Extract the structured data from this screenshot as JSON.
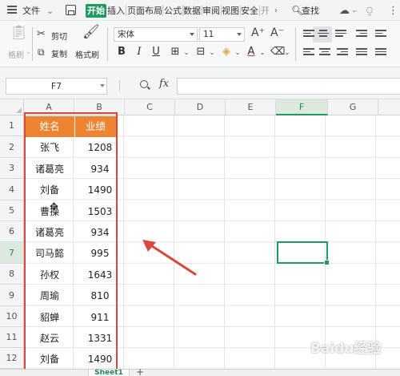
{
  "tabbar": {
    "file_menu": "文件",
    "tabs": [
      "开始",
      "插入",
      "页面布局",
      "公式",
      "数据",
      "审阅",
      "视图",
      "安全",
      "开"
    ],
    "search": "查找"
  },
  "ribbon": {
    "format_painter_disabled": "格刷",
    "cut": "剪切",
    "copy": "复制",
    "format_brush": "格式刷",
    "font_name": "宋体",
    "font_size": "11",
    "grow": "A⁺",
    "shrink": "A⁻",
    "bold": "B",
    "italic": "I",
    "underline": "U"
  },
  "formula_bar": {
    "name_box": "F7",
    "fx": "fx",
    "value": ""
  },
  "grid": {
    "columns": [
      "A",
      "B",
      "C",
      "D",
      "E",
      "F",
      "G"
    ],
    "selected_column": "F",
    "rows": [
      "1",
      "2",
      "3",
      "4",
      "5",
      "6",
      "7",
      "8",
      "9",
      "10",
      "11",
      "12"
    ],
    "selected_row": "7",
    "header": [
      "姓名",
      "业绩"
    ],
    "data": [
      [
        "张飞",
        "1208"
      ],
      [
        "诸葛亮",
        "934"
      ],
      [
        "刘备",
        "1490"
      ],
      [
        "曹操",
        "1503"
      ],
      [
        "诸葛亮",
        "934"
      ],
      [
        "司马懿",
        "995"
      ],
      [
        "孙权",
        "1643"
      ],
      [
        "周瑜",
        "810"
      ],
      [
        "貂蝉",
        "911"
      ],
      [
        "赵云",
        "1331"
      ],
      [
        "刘备",
        "1490"
      ]
    ],
    "header_color": "#ee8432",
    "annotation_color": "#d9473b",
    "selection_color": "#1e9a5c"
  },
  "sheets": {
    "active": "Sheet1",
    "add": "+"
  },
  "watermark": "Baidu经验"
}
